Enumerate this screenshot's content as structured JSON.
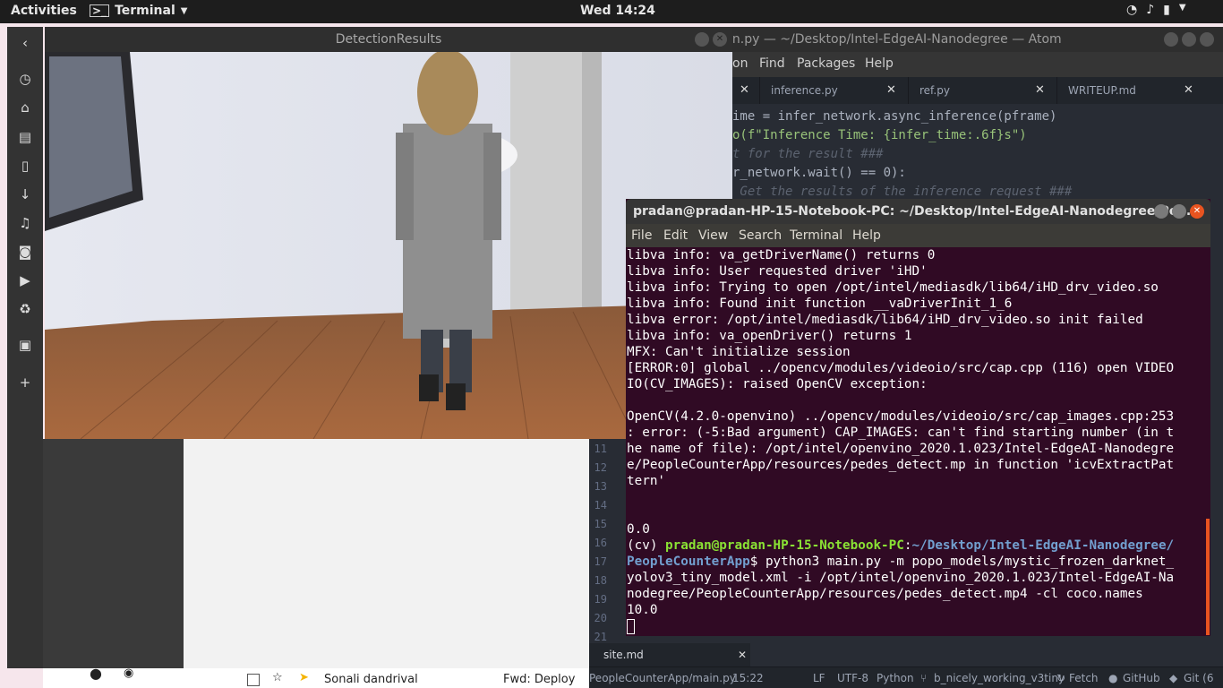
{
  "topbar": {
    "activities": "Activities",
    "app_name": "Terminal",
    "clock": "Wed 14:24"
  },
  "detection_window": {
    "title": "DetectionResults"
  },
  "atom": {
    "title": "main.py — ~/Desktop/Intel-EdgeAI-Nanodegree — Atom",
    "title_visible": "in.py — ~/Desktop/Intel-EdgeAI-Nanodegree — Atom",
    "menu": [
      "on",
      "Find",
      "Packages",
      "Help"
    ],
    "tabs": [
      "inference.py",
      "ref.py",
      "WRITEUP.md"
    ],
    "code_lines": [
      "ime = infer_network.async_inference(pframe)",
      "o(f\"Inference Time: {infer_time:.6f}s\")",
      "t for the result ###",
      "r_network.wait() == 0):",
      " Get the results of the inference request ###"
    ],
    "gutter_lines": [
      "11",
      "12",
      "13",
      "14",
      "15",
      "16",
      "17",
      "18",
      "19",
      "20",
      "21"
    ],
    "bottom_tab": "site.md",
    "status": {
      "file": "PeopleCounterApp/main.py",
      "cursor": "15:22",
      "line_ending": "LF",
      "encoding": "UTF-8",
      "grammar": "Python",
      "branch": "b_nicely_working_v3tiny",
      "fetch": "Fetch",
      "github": "GitHub",
      "git": "Git (6"
    }
  },
  "terminal": {
    "title": "pradan@pradan-HP-15-Notebook-PC: ~/Desktop/Intel-EdgeAI-Nanodegree/Peo...",
    "menu": [
      "File",
      "Edit",
      "View",
      "Search",
      "Terminal",
      "Help"
    ],
    "lines": [
      "libva info: va_getDriverName() returns 0",
      "libva info: User requested driver 'iHD'",
      "libva info: Trying to open /opt/intel/mediasdk/lib64/iHD_drv_video.so",
      "libva info: Found init function __vaDriverInit_1_6",
      "libva error: /opt/intel/mediasdk/lib64/iHD_drv_video.so init failed",
      "libva info: va_openDriver() returns 1",
      "MFX: Can't initialize session",
      "[ERROR:0] global ../opencv/modules/videoio/src/cap.cpp (116) open VIDEO",
      "IO(CV_IMAGES): raised OpenCV exception:",
      "",
      "OpenCV(4.2.0-openvino) ../opencv/modules/videoio/src/cap_images.cpp:253",
      ": error: (-5:Bad argument) CAP_IMAGES: can't find starting number (in t",
      "he name of file): /opt/intel/openvino_2020.1.023/Intel-EdgeAI-Nanodegre",
      "e/PeopleCounterApp/resources/pedes_detect.mp in function 'icvExtractPat",
      "tern'",
      "",
      "",
      "0.0"
    ],
    "prompt_prefix": "(cv) ",
    "prompt_user": "pradan@pradan-HP-15-Notebook-PC",
    "prompt_path_1": "~/Desktop/Intel-EdgeAI-Nanodegree/",
    "prompt_path_2": "PeopleCounterApp",
    "command_1": "$ python3 main.py -m popo_models/mystic_frozen_darknet_",
    "command_2": "yolov3_tiny_model.xml -i /opt/intel/openvino_2020.1.023/Intel-EdgeAI-Na",
    "command_3": "nodegree/PeopleCounterApp/resources/pedes_detect.mp4 -cl coco.names",
    "output_last": "10.0"
  },
  "mail": {
    "sender": "Sonali dandrival",
    "subject": "Fwd: Deploy"
  }
}
